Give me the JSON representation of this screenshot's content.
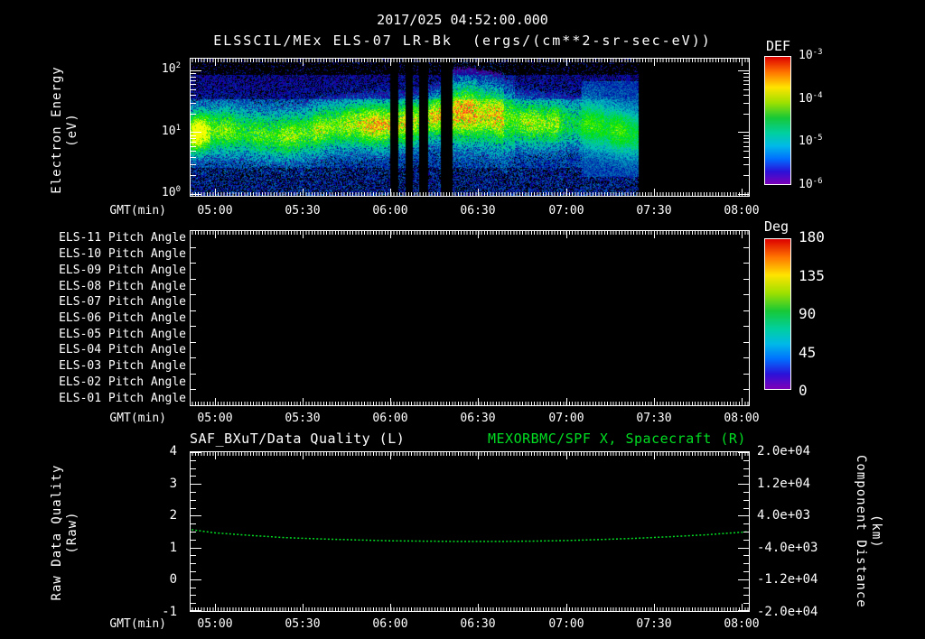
{
  "header": {
    "timestamp": "2017/025 04:52:00.000",
    "subtitle": "ELSSCIL/MEx ELS-07 LR-Bk  (ergs/(cm**2-sr-sec-eV))"
  },
  "time_axis": {
    "label": "GMT(min)",
    "ticks": [
      "05:00",
      "05:30",
      "06:00",
      "06:30",
      "07:00",
      "07:30",
      "08:00"
    ]
  },
  "panel1": {
    "ylabel_line1": "Electron Energy",
    "ylabel_line2": "(eV)",
    "yticks": [
      {
        "b": "10",
        "e": "2"
      },
      {
        "b": "10",
        "e": "1"
      },
      {
        "b": "10",
        "e": "0"
      }
    ],
    "colorbar": {
      "title": "DEF",
      "ticks": [
        {
          "b": "10",
          "e": "-3"
        },
        {
          "b": "10",
          "e": "-4"
        },
        {
          "b": "10",
          "e": "-5"
        },
        {
          "b": "10",
          "e": "-6"
        }
      ]
    }
  },
  "panel2": {
    "row_labels": [
      "ELS-11 Pitch Angle",
      "ELS-10 Pitch Angle",
      "ELS-09 Pitch Angle",
      "ELS-08 Pitch Angle",
      "ELS-07 Pitch Angle",
      "ELS-06 Pitch Angle",
      "ELS-05 Pitch Angle",
      "ELS-04 Pitch Angle",
      "ELS-03 Pitch Angle",
      "ELS-02 Pitch Angle",
      "ELS-01 Pitch Angle"
    ],
    "colorbar": {
      "title": "Deg",
      "ticks": [
        "180",
        "135",
        "90",
        "45",
        "0"
      ]
    }
  },
  "panel3": {
    "title_left": "SAF_BXuT/Data Quality (L)",
    "title_right": "MEXORBMC/SPF X, Spacecraft (R)",
    "ylabel_left_line1": "Raw Data Quality",
    "ylabel_left_line2": "(Raw)",
    "ylabel_right_line1": "Component Distance",
    "ylabel_right_line2": "(km)",
    "left_ticks": [
      "4",
      "3",
      "2",
      "1",
      "0",
      "-1"
    ],
    "right_ticks": [
      "2.0e+04",
      "1.2e+04",
      "4.0e+03",
      "-4.0e+03",
      "-1.2e+04",
      "-2.0e+04"
    ]
  },
  "colors": {
    "accent_green": "#00dd22",
    "plot_fg": "#ffffff",
    "background": "#000000"
  },
  "chart_data": [
    {
      "type": "heatmap",
      "name": "electron-energy-spectrogram",
      "instrument": "ELSSCIL/MEx ELS-07 LR-Bk",
      "units": "ergs/(cm**2-sr-sec-eV)",
      "x_axis": {
        "label": "GMT(min)",
        "start": "04:52",
        "end": "08:02",
        "ticks": [
          "05:00",
          "05:30",
          "06:00",
          "06:30",
          "07:00",
          "07:30",
          "08:00"
        ]
      },
      "y_axis": {
        "label": "Electron Energy (eV)",
        "scale": "log",
        "min": 1,
        "max": 158
      },
      "color_axis": {
        "label": "DEF",
        "scale": "log",
        "min": 1e-06,
        "max": 0.001
      },
      "features": {
        "main_band": "enhanced flux band between ~5 and 40 eV across the whole interval, brightest (~1e-4, yellow-green) from ~05:20 to 06:35",
        "left_blob": "bright green patch near 10 eV at ~04:53",
        "background": "weak flux (1e-6 to 1e-5, blue/purple speckle) from 1 to ~100 eV",
        "data_gaps_gmt": [
          [
            "06:00",
            "06:03"
          ],
          [
            "06:05",
            "06:08"
          ],
          [
            "06:09",
            "06:13"
          ],
          [
            "06:17",
            "06:21"
          ]
        ],
        "data_end_gmt": "07:24"
      },
      "render": {
        "gaps_frac": [
          [
            0.356,
            0.372
          ],
          [
            0.385,
            0.398
          ],
          [
            0.408,
            0.424
          ],
          [
            0.448,
            0.469
          ]
        ],
        "end_frac": 0.802
      }
    },
    {
      "type": "heatmap",
      "name": "pitch-angle-panels",
      "rows": [
        "ELS-11",
        "ELS-10",
        "ELS-09",
        "ELS-08",
        "ELS-07",
        "ELS-06",
        "ELS-05",
        "ELS-04",
        "ELS-03",
        "ELS-02",
        "ELS-01"
      ],
      "color_axis": {
        "label": "Deg",
        "min": 0,
        "max": 180,
        "ticks": [
          180,
          135,
          90,
          45,
          0
        ]
      },
      "values": "no data plotted (blank panel)"
    },
    {
      "type": "line",
      "name": "data-quality-and-spacecraft-distance",
      "titles": {
        "left": "SAF_BXuT/Data Quality (L)",
        "right": "MEXORBMC/SPF X, Spacecraft (R)"
      },
      "x_axis": {
        "label": "GMT(min)",
        "ticks": [
          "05:00",
          "05:30",
          "06:00",
          "06:30",
          "07:00",
          "07:30",
          "08:00"
        ]
      },
      "left_axis": {
        "label": "Raw Data Quality (Raw)",
        "min": -1,
        "max": 4,
        "ticks": [
          4,
          3,
          2,
          1,
          0,
          -1
        ]
      },
      "right_axis": {
        "label": "Component Distance (km)",
        "min": -20000,
        "max": 20000,
        "ticks": [
          20000,
          12000,
          4000,
          -4000,
          -12000,
          -20000
        ]
      },
      "series": [
        {
          "name": "visible green curve",
          "color": "#00dd22",
          "x_minutes_after_0500": [
            -8,
            0,
            12,
            24,
            36,
            48,
            60,
            72,
            84,
            96,
            108,
            120,
            132,
            144,
            156,
            168,
            180,
            182
          ],
          "y_left_axis_units": [
            1.56,
            1.46,
            1.38,
            1.31,
            1.27,
            1.24,
            1.21,
            1.2,
            1.19,
            1.19,
            1.2,
            1.22,
            1.25,
            1.29,
            1.34,
            1.4,
            1.48,
            1.5
          ]
        }
      ]
    }
  ]
}
